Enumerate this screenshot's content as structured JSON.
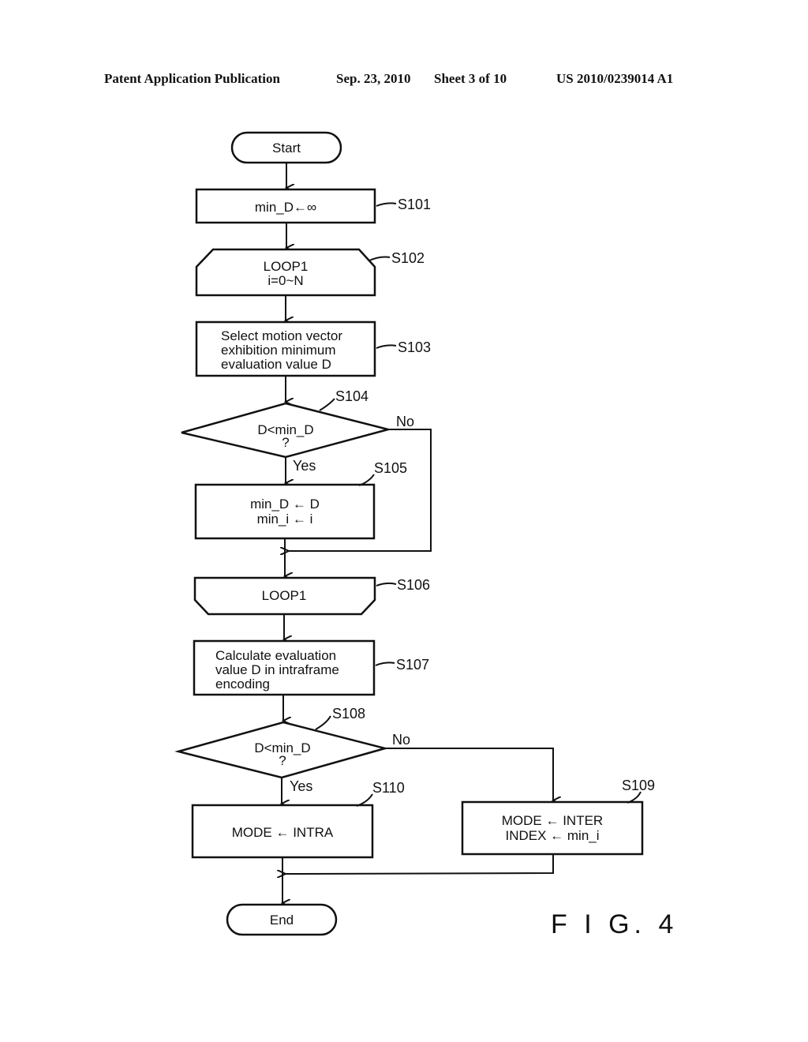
{
  "header": {
    "publication": "Patent Application Publication",
    "date": "Sep. 23, 2010",
    "sheet": "Sheet 3 of 10",
    "number": "US 2010/0239014 A1"
  },
  "flowchart": {
    "start": "Start",
    "end": "End",
    "figure_label": "F I G. 4",
    "steps": {
      "s101": {
        "label": "S101",
        "lines": [
          "min_D←∞"
        ]
      },
      "s102": {
        "label": "S102",
        "lines": [
          "LOOP1",
          "i=0~N"
        ]
      },
      "s103": {
        "label": "S103",
        "lines": [
          "Select motion vector",
          "exhibition minimum",
          "evaluation value D"
        ]
      },
      "s104": {
        "label": "S104",
        "lines": [
          "D<min_D",
          "?"
        ],
        "yes": "Yes",
        "no": "No"
      },
      "s105": {
        "label": "S105",
        "lines": [
          "min_D ← D",
          "min_i ← i"
        ]
      },
      "s106": {
        "label": "S106",
        "lines": [
          "LOOP1"
        ]
      },
      "s107": {
        "label": "S107",
        "lines": [
          "Calculate evaluation",
          "value D in intraframe",
          "encoding"
        ]
      },
      "s108": {
        "label": "S108",
        "lines": [
          "D<min_D",
          "?"
        ],
        "yes": "Yes",
        "no": "No"
      },
      "s109": {
        "label": "S109",
        "lines": [
          "MODE ← INTER",
          "INDEX ← min_i"
        ]
      },
      "s110": {
        "label": "S110",
        "lines": [
          "MODE ← INTRA"
        ]
      }
    }
  }
}
